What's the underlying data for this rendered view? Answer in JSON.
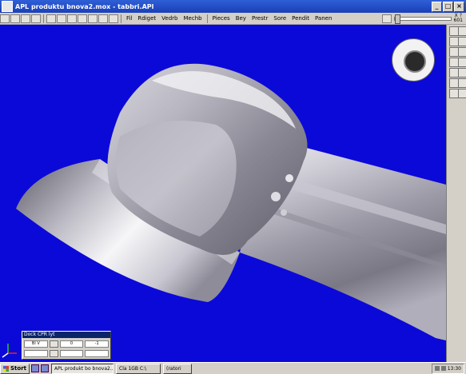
{
  "window": {
    "title": "APL produktu bnova2.mox - tabbri.APl",
    "controls": {
      "minimize": "_",
      "maximize": "□",
      "close": "×"
    }
  },
  "menu": {
    "items": [
      "Fil",
      "Rdiget",
      "Vedrb",
      "Mechb",
      "Pieces",
      "Bey",
      "Prestr",
      "Sore",
      "Pendit",
      "Panen"
    ]
  },
  "zoom": {
    "level_top": "X ?",
    "level_bottom": "601",
    "slider_position": 0.0
  },
  "viewport": {
    "background": "#0b09d8",
    "object": "3D rendered metallic pipe fitting"
  },
  "panel": {
    "title": "Dock CPR lyt",
    "fields": [
      "Bl V",
      "0",
      "-1"
    ],
    "row2": [
      "",
      "",
      ""
    ]
  },
  "taskbar": {
    "start_label": "Stort",
    "tasks": [
      {
        "label": "APL produkt bo bnova2...",
        "active": true
      },
      {
        "label": "Cla 1GB C:\\",
        "active": false
      },
      {
        "label": "(ratori",
        "active": false
      }
    ],
    "clock": "13:30"
  },
  "colors": {
    "accent_titlebar": "#1a3fb8",
    "viewport_bg": "#0b09d8",
    "chrome": "#d4d0c8"
  }
}
